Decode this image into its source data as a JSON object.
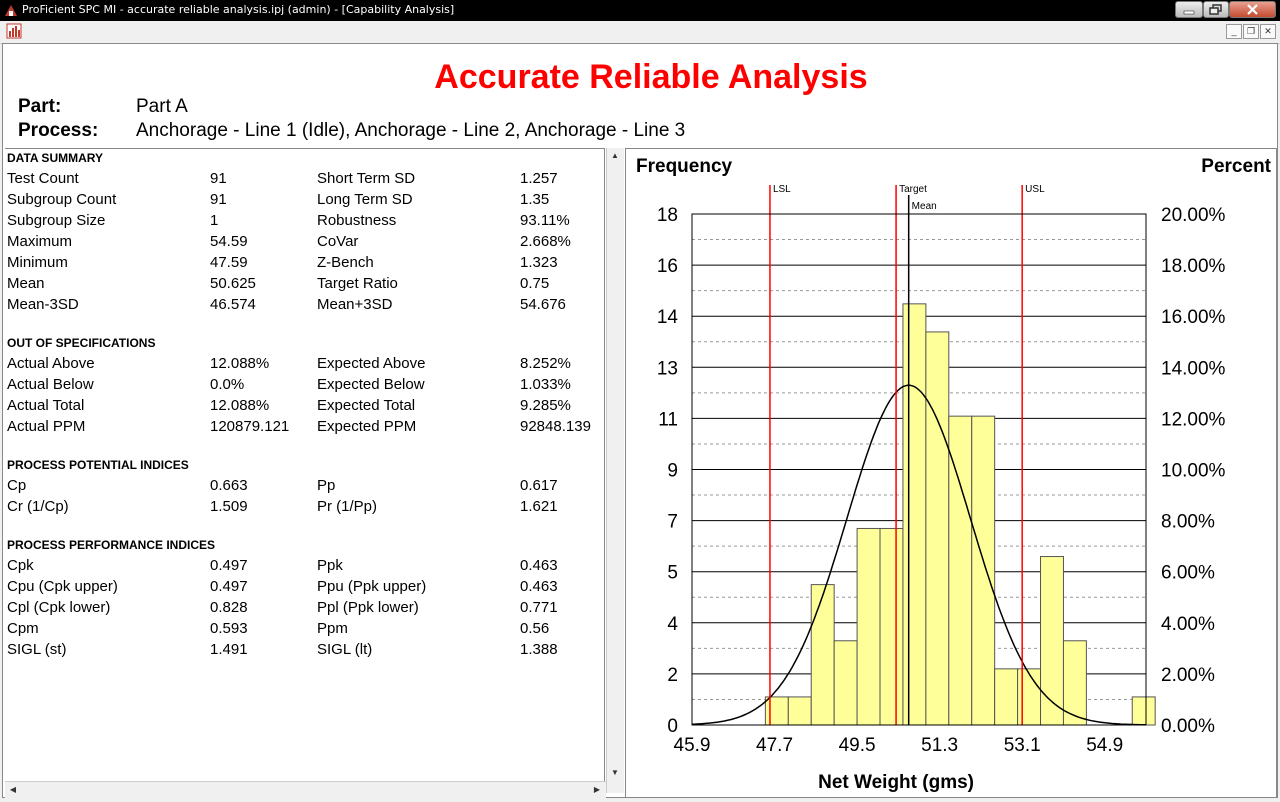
{
  "window": {
    "title": "ProFicient SPC MI - accurate reliable analysis.ipj (admin) - [Capability Analysis]",
    "min_label": "–",
    "max_label": "□",
    "close_label": "✕"
  },
  "report": {
    "title": "Accurate Reliable Analysis",
    "part_label": "Part:",
    "part_value": "Part A",
    "process_label": "Process:",
    "process_value": "Anchorage - Line 1 (Idle), Anchorage - Line 2, Anchorage - Line 3"
  },
  "summary": {
    "sections": [
      {
        "heading": "DATA SUMMARY",
        "rows": [
          [
            "Test Count",
            "91",
            "Short Term SD",
            "1.257"
          ],
          [
            "Subgroup Count",
            "91",
            "Long Term SD",
            "1.35"
          ],
          [
            "Subgroup Size",
            "1",
            "Robustness",
            "93.11%"
          ],
          [
            "Maximum",
            "54.59",
            "CoVar",
            "2.668%"
          ],
          [
            "Minimum",
            "47.59",
            "Z-Bench",
            "1.323"
          ],
          [
            "Mean",
            "50.625",
            "Target Ratio",
            "0.75"
          ],
          [
            "Mean-3SD",
            "46.574",
            "Mean+3SD",
            "54.676"
          ]
        ]
      },
      {
        "heading": "OUT OF SPECIFICATIONS",
        "rows": [
          [
            "Actual Above",
            "12.088%",
            "Expected Above",
            "8.252%"
          ],
          [
            "Actual Below",
            "0.0%",
            "Expected Below",
            "1.033%"
          ],
          [
            "Actual Total",
            "12.088%",
            "Expected Total",
            "9.285%"
          ],
          [
            "Actual PPM",
            "120879.121",
            "Expected PPM",
            "92848.139"
          ]
        ]
      },
      {
        "heading": "PROCESS POTENTIAL INDICES",
        "rows": [
          [
            "Cp",
            "0.663",
            "Pp",
            "0.617"
          ],
          [
            "Cr (1/Cp)",
            "1.509",
            "Pr (1/Pp)",
            "1.621"
          ]
        ]
      },
      {
        "heading": "PROCESS PERFORMANCE INDICES",
        "rows": [
          [
            "Cpk",
            "0.497",
            "Ppk",
            "0.463"
          ],
          [
            "Cpu (Cpk upper)",
            "0.497",
            "Ppu (Ppk upper)",
            "0.463"
          ],
          [
            "Cpl (Cpk lower)",
            "0.828",
            "Ppl (Ppk lower)",
            "0.771"
          ],
          [
            "Cpm",
            "0.593",
            "Ppm",
            "0.56"
          ],
          [
            "SIGL (st)",
            "1.491",
            "SIGL (lt)",
            "1.388"
          ]
        ]
      }
    ]
  },
  "chart_data": {
    "type": "bar",
    "title": "",
    "ylabel": "Frequency",
    "y2label": "Percent",
    "xlabel": "Net Weight (gms)",
    "x_ticks": [
      "45.9",
      "47.7",
      "49.5",
      "51.3",
      "53.1",
      "54.9"
    ],
    "x_range": [
      45.9,
      55.8
    ],
    "y_ticks": [
      "0",
      "2",
      "4",
      "5",
      "7",
      "9",
      "11",
      "13",
      "14",
      "16",
      "18"
    ],
    "y_range": [
      0,
      18.2
    ],
    "y2_ticks": [
      "0.00%",
      "2.00%",
      "4.00%",
      "6.00%",
      "8.00%",
      "10.00%",
      "12.00%",
      "14.00%",
      "16.00%",
      "18.00%",
      "20.00%"
    ],
    "bin_start": 47.5,
    "bin_width": 0.5,
    "values": [
      1,
      1,
      5,
      3,
      7,
      7,
      15,
      14,
      11,
      11,
      2,
      2,
      6,
      3,
      0,
      0,
      1
    ],
    "bar_color": "#ffff99",
    "normal_curve": {
      "mean": 50.625,
      "sd": 1.35,
      "peak": 12.1,
      "color": "#000000"
    },
    "spec_lines": [
      {
        "name": "LSL",
        "x": 47.6,
        "color": "#ff0000"
      },
      {
        "name": "Target",
        "x": 50.35,
        "color": "#ff0000"
      },
      {
        "name": "USL",
        "x": 53.1,
        "color": "#ff0000"
      }
    ],
    "mean_line": {
      "name": "Mean",
      "x": 50.625,
      "color": "#000000"
    },
    "grid": true
  }
}
